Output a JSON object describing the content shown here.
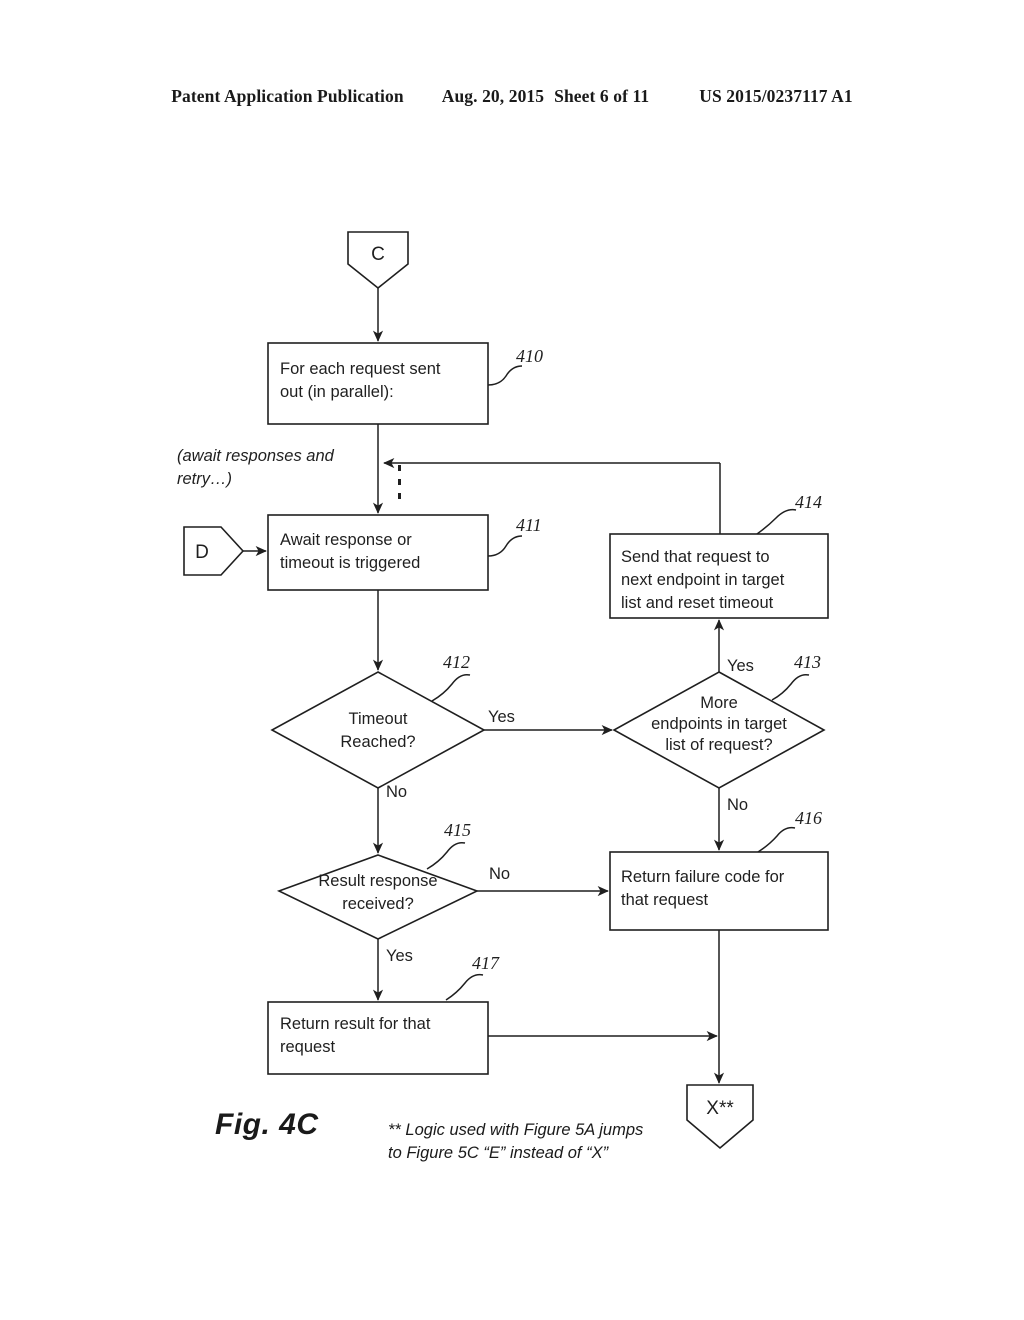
{
  "header": {
    "publication": "Patent Application Publication",
    "date": "Aug. 20, 2015",
    "sheet": "Sheet 6 of 11",
    "patent_number": "US 2015/0237117 A1"
  },
  "figure": {
    "caption": "Fig. 4C",
    "footnote_line1": "** Logic used with Figure 5A jumps",
    "footnote_line2": "to Figure 5C “E” instead of “X”",
    "aside_note_line1": "(await responses and",
    "aside_note_line2": "retry…)"
  },
  "connectors": {
    "entry_c": "C",
    "entry_d": "D",
    "exit_x": "X**"
  },
  "nodes": [
    {
      "id": "410",
      "ref": "410",
      "type": "process",
      "lines": [
        "For each request sent",
        "out (in parallel):"
      ]
    },
    {
      "id": "411",
      "ref": "411",
      "type": "process",
      "lines": [
        "Await response or",
        "timeout is triggered"
      ]
    },
    {
      "id": "412",
      "ref": "412",
      "type": "decision",
      "lines": [
        "Timeout",
        "Reached?"
      ]
    },
    {
      "id": "413",
      "ref": "413",
      "type": "decision",
      "lines": [
        "More",
        "endpoints in target",
        "list of request?"
      ]
    },
    {
      "id": "414",
      "ref": "414",
      "type": "process",
      "lines": [
        "Send that request to",
        "next endpoint in target",
        "list and reset timeout"
      ]
    },
    {
      "id": "415",
      "ref": "415",
      "type": "decision",
      "lines": [
        "Result response",
        "received?"
      ]
    },
    {
      "id": "416",
      "ref": "416",
      "type": "process",
      "lines": [
        "Return failure code for",
        "that request"
      ]
    },
    {
      "id": "417",
      "ref": "417",
      "type": "process",
      "lines": [
        "Return result for that",
        "request"
      ]
    }
  ],
  "branch_labels": {
    "timeout_yes": "Yes",
    "timeout_no": "No",
    "more_endpoints_yes": "Yes",
    "more_endpoints_no": "No",
    "result_no": "No",
    "result_yes": "Yes"
  }
}
